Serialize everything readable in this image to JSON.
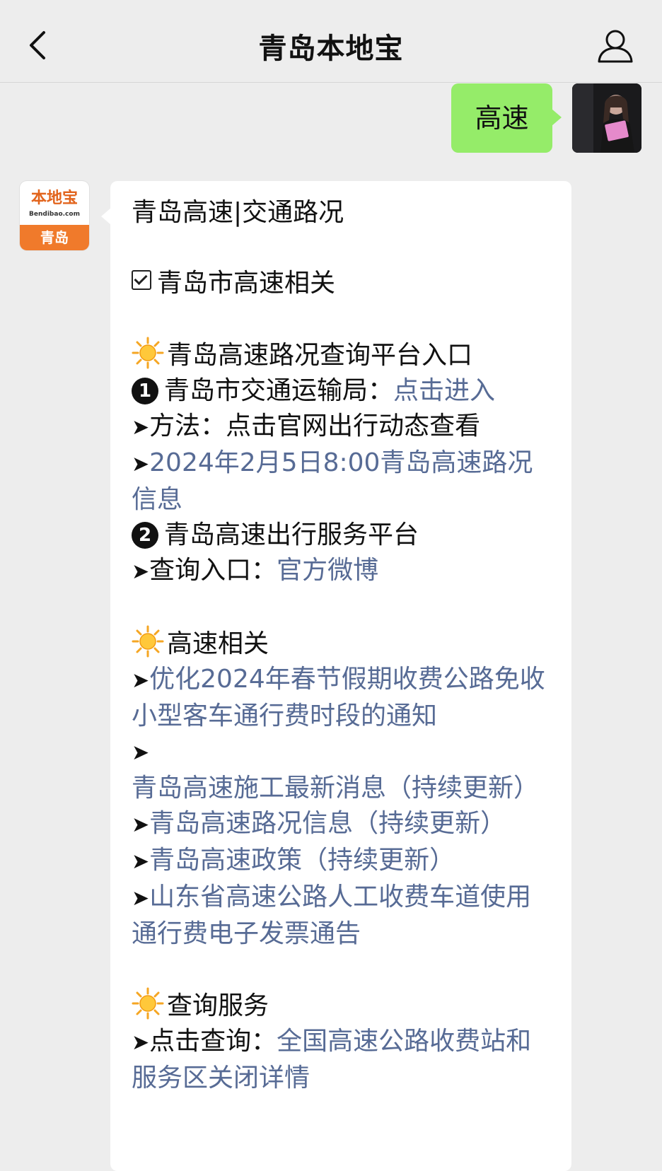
{
  "header": {
    "title": "青岛本地宝"
  },
  "outgoing": {
    "text": "高速"
  },
  "bot_logo": {
    "main": "本地宝",
    "sub": "Bendibao.com",
    "city": "青岛"
  },
  "message": {
    "title": "青岛高速|交通路况",
    "tag": "青岛市高速相关",
    "section1": {
      "heading": "青岛高速路况查询平台入口",
      "item1_num": "1",
      "item1_label": "青岛市交通运输局：",
      "item1_link": "点击进入",
      "method_label": "方法：点击官网出行动态查看",
      "news_link": "2024年2月5日8:00青岛高速路况信息",
      "item2_num": "2",
      "item2_label": "青岛高速出行服务平台",
      "query_label": "查询入口：",
      "query_link": "官方微博"
    },
    "section2": {
      "heading": "高速相关",
      "links": [
        "优化2024年春节假期收费公路免收小型客车通行费时段的通知",
        "青岛高速施工最新消息（持续更新）",
        "青岛高速路况信息（持续更新）",
        "青岛高速政策（持续更新）",
        "山东省高速公路人工收费车道使用通行费电子发票通告"
      ]
    },
    "section3": {
      "heading": "查询服务",
      "click_label": "点击查询：",
      "click_link": "全国高速公路收费站和服务区关闭详情"
    }
  },
  "colors": {
    "background": "#ededed",
    "my_bubble": "#95ec69",
    "link": "#576b95",
    "brand_orange": "#f07a2b"
  }
}
